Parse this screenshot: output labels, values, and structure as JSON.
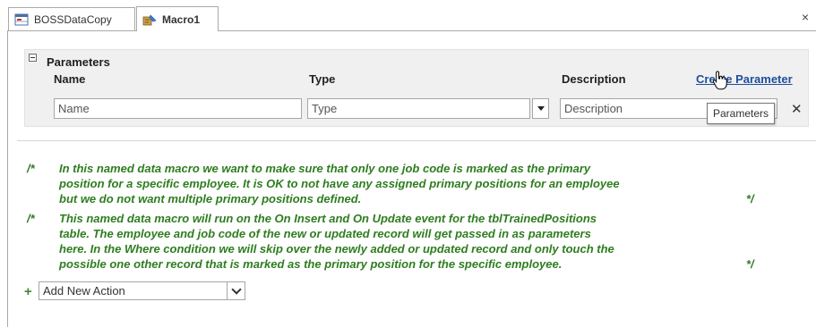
{
  "tabs": [
    {
      "label": "BOSSDataCopy",
      "icon": "table-icon",
      "active": false
    },
    {
      "label": "Macro1",
      "icon": "macro-icon",
      "active": true
    }
  ],
  "close_glyph": "×",
  "parameters": {
    "title": "Parameters",
    "columns": {
      "name": "Name",
      "type": "Type",
      "description": "Description"
    },
    "create_link": "Create Parameter",
    "row": {
      "name_placeholder": "Name",
      "type_placeholder": "Type",
      "description_placeholder": "Description"
    },
    "delete_glyph": "✕",
    "tooltip": "Parameters"
  },
  "comments": [
    {
      "open": "/*",
      "lines": [
        "In this named data macro we want to make sure that only one job code is marked as the primary",
        "position for a specific employee. It is OK to not have any assigned primary positions for an employee",
        "but we do not want multiple primary positions defined."
      ],
      "close": "*/"
    },
    {
      "open": "/*",
      "lines": [
        "This named data macro will run on the On Insert and On Update event for the tblTrainedPositions",
        "table. The employee and job code of the new or updated record will get passed in as parameters",
        "here. In the Where condition we will skip over the newly added or updated record and only touch the",
        "possible one other record that is marked as the primary position for the specific employee."
      ],
      "close": "*/"
    }
  ],
  "add_action": {
    "plus": "+",
    "label": "Add New Action"
  },
  "colors": {
    "comment": "#2e7d1f",
    "link": "#1f4e9c",
    "plus": "#3f8a2e"
  }
}
